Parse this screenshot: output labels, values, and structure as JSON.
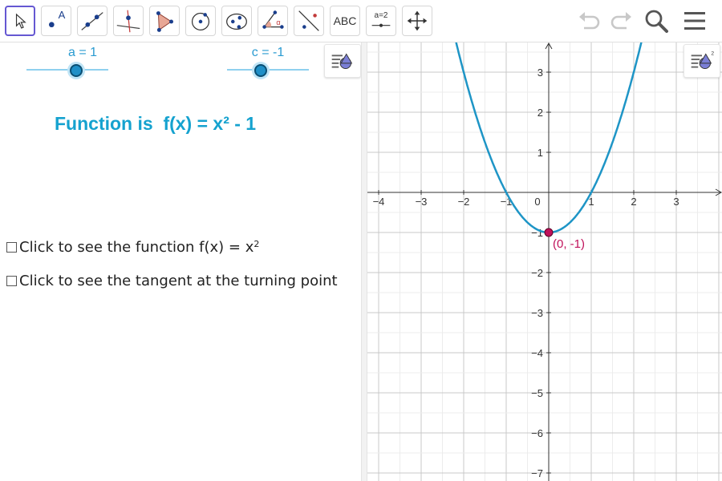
{
  "toolbar": {
    "tools": [
      {
        "name": "move-tool",
        "label": ""
      },
      {
        "name": "point-tool",
        "label": "A"
      },
      {
        "name": "line-tool",
        "label": ""
      },
      {
        "name": "perpendicular-line-tool",
        "label": ""
      },
      {
        "name": "polygon-tool",
        "label": ""
      },
      {
        "name": "circle-tool",
        "label": ""
      },
      {
        "name": "conic-tool",
        "label": ""
      },
      {
        "name": "angle-tool",
        "label": "α"
      },
      {
        "name": "reflect-tool",
        "label": ""
      },
      {
        "name": "text-tool",
        "label": "ABC"
      },
      {
        "name": "slider-tool",
        "label": "a=2"
      },
      {
        "name": "move-graphics-tool",
        "label": ""
      }
    ],
    "right_icons": [
      "undo-icon",
      "redo-icon",
      "search-icon",
      "menu-icon"
    ]
  },
  "algebra": {
    "sliders": [
      {
        "label": "a = 1",
        "value": 1
      },
      {
        "label": "c = -1",
        "value": -1
      }
    ],
    "function_text": "Function is  f(x) = x² - 1",
    "checkboxes": [
      {
        "label_main": "Click to see the function f(x) = x",
        "label_sup": "2",
        "checked": false
      },
      {
        "label_main": "Click to see the tangent at the turning point",
        "label_sup": "",
        "checked": false
      }
    ]
  },
  "graphics": {
    "point_label": "(0, -1)",
    "x_ticks": [
      "−4",
      "−3",
      "−2",
      "−1",
      "0",
      "1",
      "2",
      "3"
    ],
    "y_ticks": [
      "3",
      "2",
      "1",
      "−1",
      "−2",
      "−3",
      "−4",
      "−5",
      "−6",
      "−7"
    ]
  },
  "colors": {
    "curve": "#1e95c6",
    "point": "#c0115a",
    "accent": "#15a2cf",
    "slider": "#2a9bd1",
    "active_tool": "#6557d2"
  }
}
